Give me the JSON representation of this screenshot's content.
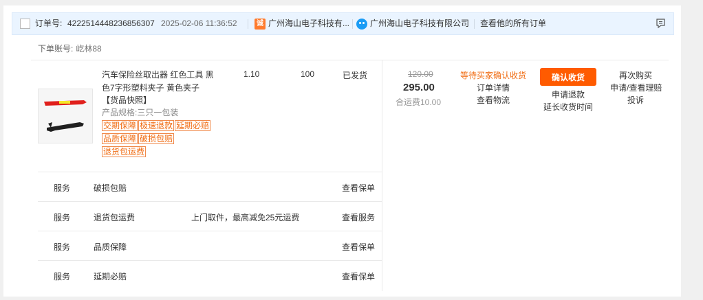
{
  "order": {
    "id_label": "订单号:",
    "id_value": "4222514448236856307",
    "datetime": "2025-02-06 11:36:52",
    "shop_name": "广州海山电子科技有...",
    "ww_name": "广州海山电子科技有限公司",
    "all_orders_link": "查看他的所有订单",
    "account_label": "下单账号:",
    "account_value": "屹林88"
  },
  "item": {
    "title": "汽车保险丝取出器 红色工具 黑色7字形塑料夹子 黄色夹子",
    "snapshot": "【货品快照】",
    "spec": "产品规格:三只一包装",
    "badges": [
      "交期保障",
      "极速退款",
      "延期必赔",
      "品质保障",
      "破损包赔",
      "退货包运费"
    ],
    "unit_price": "1.10",
    "quantity": "100",
    "ship_status": "已发货"
  },
  "payment": {
    "original": "120.00",
    "total": "295.00",
    "shipping": "合运费10.00"
  },
  "status": {
    "text": "等待买家确认收货",
    "detail_link": "订单详情",
    "logistics_link": "查看物流"
  },
  "actions": {
    "confirm_button": "确认收货",
    "refund_link": "申请退款",
    "extend_link": "延长收货时间",
    "rebuy_link": "再次购买",
    "claim_link": "申请/查看理赔",
    "complain_link": "投诉"
  },
  "services": [
    {
      "label": "服务",
      "name": "破损包赔",
      "desc": "",
      "link": "查看保单"
    },
    {
      "label": "服务",
      "name": "退货包运费",
      "desc": "上门取件，最高减免25元运费",
      "link": "查看服务"
    },
    {
      "label": "服务",
      "name": "品质保障",
      "desc": "",
      "link": "查看保单"
    },
    {
      "label": "服务",
      "name": "延期必赔",
      "desc": "",
      "link": "查看保单"
    }
  ],
  "colors": {
    "accent": "#ff5b00",
    "status_orange": "#f06a0f",
    "header_bg": "#eaf4ff"
  },
  "icons": [
    "checkbox-icon",
    "shop-icon",
    "wangwang-icon",
    "flag-icon"
  ]
}
